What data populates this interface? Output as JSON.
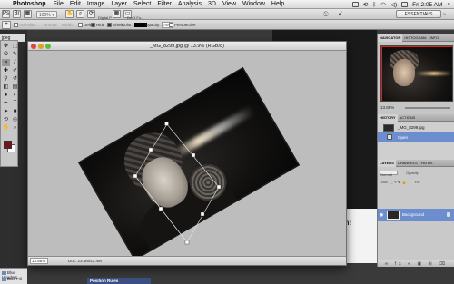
{
  "menubar": {
    "apple_glyph": "",
    "app_name": "Photoshop",
    "items": [
      "File",
      "Edit",
      "Image",
      "Layer",
      "Select",
      "Filter",
      "Analysis",
      "3D",
      "View",
      "Window",
      "Help"
    ],
    "clock": "Fri 2:05 AM"
  },
  "options_bar": {
    "antialias_label": "Anti-alias",
    "style_label": "Normal",
    "width_label": "Width:",
    "essentials_label": "ESSENTIALS",
    "cancel_glyph": "⃠",
    "commit_glyph": "✓"
  },
  "crop_options": {
    "cropped_area_label": "Digital P",
    "delete_label": "Delete",
    "hide_label": "Hide",
    "shield_label": "Shield",
    "color_label": "Color:",
    "opacity_label": "Opacity:",
    "opacity_value": "75%",
    "perspective_label": "Perspective",
    "dont_fix_label": "Don't Fu..."
  },
  "background_tab": {
    "label": "jpeg"
  },
  "document": {
    "title": "_MG_8299.jpg @ 13.9% (RGB/8)",
    "zoom": "13.88%",
    "doc_info": "Doc: 23.4M/23.4M"
  },
  "navigator": {
    "tabs": [
      "NAVIGATOR",
      "HISTOGRAM",
      "INFO"
    ],
    "zoom": "13.88%"
  },
  "history": {
    "tabs": [
      "HISTORY",
      "ACTIONS"
    ],
    "items": [
      "_MG_8299.jpg",
      "Open"
    ]
  },
  "layers": {
    "tabs": [
      "LAYERS",
      "CHANNELS",
      "PATHS"
    ],
    "blend_mode": "Normal",
    "opacity_label": "Opacity:",
    "lock_label": "Lock:",
    "fill_label": "Fill:",
    "layer_name": "Background",
    "footer_glyphs": "∞ fx ◐ ▣ ⊞ ⌫"
  },
  "styles_palette": {
    "items": [
      "Blue Headers",
      "Blue Fill"
    ]
  },
  "bottom_window": {
    "bar_label": "Position Rules",
    "partial_text": "ren!"
  },
  "colors": {
    "foreground": "#7a0f1e",
    "background": "#ffffff",
    "selection": "#6c8ecf",
    "crop_shield": "#bdbdbd"
  },
  "icons": {
    "tools": [
      "move-icon",
      "marquee-icon",
      "lasso-icon",
      "quick-select-icon",
      "crop-icon",
      "eyedropper-icon",
      "healing-icon",
      "brush-icon",
      "clone-stamp-icon",
      "history-brush-icon",
      "eraser-icon",
      "gradient-icon",
      "blur-icon",
      "dodge-icon",
      "pen-icon",
      "type-icon",
      "path-select-icon",
      "shape-icon",
      "3d-rotate-icon",
      "3d-orbit-icon",
      "hand-icon",
      "zoom-icon"
    ]
  }
}
